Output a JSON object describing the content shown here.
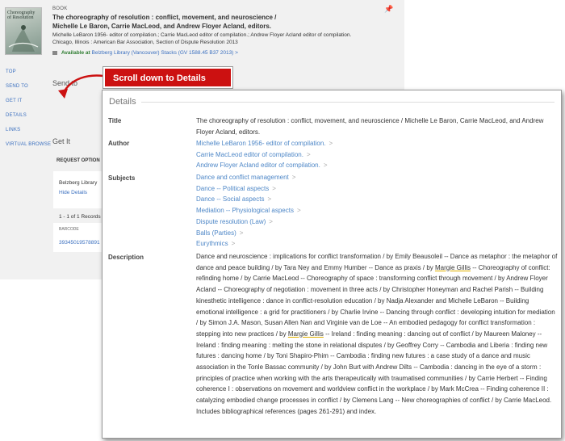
{
  "record": {
    "type": "BOOK",
    "cover_title": "Choreography of Resolution",
    "title": "The choreography of resolution : conflict, movement, and neuroscience / Michelle Le Baron, Carrie MacLeod, and Andrew Floyer Acland, editors.",
    "authors_line": "Michelle LeBaron 1956- editor of compilation.; Carrie MacLeod editor of compilation.; Andrew Floyer Acland editor of compilation.",
    "publisher_line": "Chicago, Illinois : American Bar Association, Section of Dispute Resolution 2013",
    "availability_status": "Available at",
    "availability_location": "Belzberg Library (Vancouver)  Stacks (GV 1588.45 B37 2013)",
    "availability_chevron": ">"
  },
  "nav": {
    "items": [
      "TOP",
      "SEND TO",
      "GET IT",
      "DETAILS",
      "LINKS",
      "VIRTUAL BROWSE"
    ]
  },
  "sections": {
    "send_to": "Send to",
    "get_it": "Get It",
    "request_options": "REQUEST OPTION",
    "library": "Belzberg Library",
    "hide_details": "Hide Details",
    "records": "1 - 1 of 1 Records",
    "barcode_label": "BARCODE",
    "barcode": "39345019578891"
  },
  "callout": {
    "text": "Scroll down to Details"
  },
  "details": {
    "heading": "Details",
    "title_label": "Title",
    "title_value": "The choreography of resolution : conflict, movement, and neuroscience / Michelle Le Baron, Carrie MacLeod, and Andrew Floyer Acland, editors.",
    "author_label": "Author",
    "authors": [
      "Michelle LeBaron 1956- editor of compilation.",
      "Carrie MacLeod editor of compilation.",
      "Andrew Floyer Acland editor of compilation."
    ],
    "subjects_label": "Subjects",
    "subjects": [
      "Dance and conflict management",
      "Dance -- Political aspects",
      "Dance -- Social aspects",
      "Mediation -- Physiological aspects",
      "Dispute resolution (Law)",
      "Balls (Parties)",
      "Eurythmics"
    ],
    "chevron": ">",
    "description_label": "Description",
    "description_parts": [
      "Dance and neuroscience : implications for conflict transformation / by Emily Beausoleil -- Dance as metaphor : the metaphor of dance and peace building / by Tara Ney and Emmy Humber -- Dance as praxis / by ",
      "Margie Gillis",
      " -- Choreography of conflict: refinding home / by Carrie MacLeod -- Choreography of space : transforming conflict through movement / by Andrew Floyer Acland -- Choreography of negotiation : movement in three acts / by Christopher Honeyman and Rachel Parish -- Building kinesthetic intelligence : dance in conflict-resolution education / by Nadja Alexander and Michelle LeBaron -- Building emotional intelligence : a grid for practitioners / by Charlie Irvine -- Dancing through conflict : developing intuition for mediation / by Simon J.A. Mason, Susan Allen Nan and Virginie van de Loe -- An embodied pedagogy for conflict transformation : stepping into new practices / by ",
      "Margie Gillis",
      " -- Ireland : finding meaning : dancing out of conflict / by Maureen Maloney -- Ireland : finding meaning : melting the stone in relational disputes / by Geoffrey Corry -- Cambodia and Liberia : finding new futures : dancing home / by Toni Shapiro-Phim -- Cambodia : finding new futures : a case study of a dance and music association in the Tonle Bassac community / by John Burt with Andrew Dilts -- Cambodia : dancing in the eye of a storm : principles of practice when working with the arts therapeutically with traumatised communities / by Carrie Herbert -- Finding coherence I : observations on movement and worldview conflict in the workplace / by Mark McCrea -- Finding coherence II : catalyzing embodied change processes in conflict / by Clemens Lang -- New choreographies of conflict / by Carrie MacLeod."
    ],
    "description_note": "Includes bibliographical references (pages 261-291) and index."
  },
  "colors": {
    "link": "#4e87c7",
    "callout": "#cc1111",
    "available": "#2f7d32"
  },
  "icons": [
    "pin-icon",
    "arrow-icon",
    "chevron-icon",
    "book-type-icon"
  ]
}
